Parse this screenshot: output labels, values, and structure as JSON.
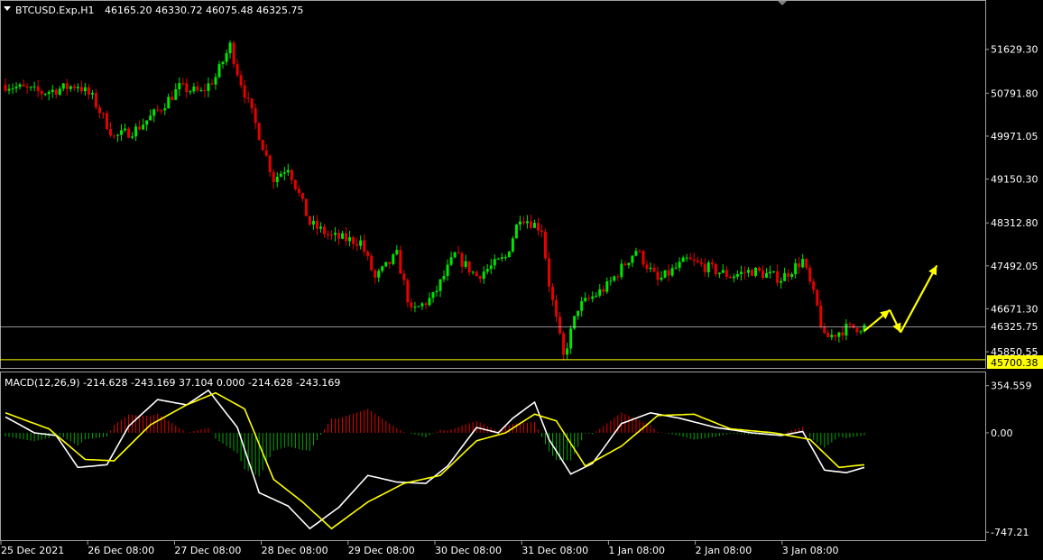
{
  "header": {
    "symbol": "BTCUSD.Exp,H1",
    "ohlc": "46165.20 46330.72 46075.48 46325.75"
  },
  "macd_header": "MACD(12,26,9) -214.628 -243.169 37.104 0.000 -214.628 -243.169",
  "colors": {
    "background": "#000000",
    "bull": "#00e600",
    "bear": "#e60000",
    "macd_line": "#ffffff",
    "signal_line": "#ffff00",
    "hist_pos": "#e60000",
    "hist_neg": "#00aa00",
    "price_line": "#c0c0c0",
    "support_line": "#ffff00",
    "support_label_bg": "#ffff00",
    "arrows": "#ffff00"
  },
  "chart_data": [
    {
      "type": "candlestick",
      "y_ticks": [
        51629.3,
        50791.8,
        49971.05,
        49150.3,
        48312.8,
        47492.05,
        46671.3,
        45850.55
      ],
      "ylim": [
        45680,
        52400
      ],
      "current_price": "46325.75",
      "support_level": "45700.38",
      "x_tick_labels": [
        "25 Dec 2021",
        "26 Dec 08:00",
        "27 Dec 08:00",
        "28 Dec 08:00",
        "29 Dec 08:00",
        "30 Dec 08:00",
        "31 Dec 08:00",
        "1 Jan 08:00",
        "2 Jan 08:00",
        "3 Jan 08:00"
      ],
      "close_path_anchors": [
        [
          0,
          50950
        ],
        [
          10,
          50800
        ],
        [
          20,
          50950
        ],
        [
          24,
          50700
        ],
        [
          30,
          49950
        ],
        [
          36,
          50100
        ],
        [
          42,
          50450
        ],
        [
          48,
          50900
        ],
        [
          54,
          50800
        ],
        [
          58,
          51100
        ],
        [
          62,
          51700
        ],
        [
          64,
          51200
        ],
        [
          70,
          50000
        ],
        [
          74,
          49150
        ],
        [
          78,
          49400
        ],
        [
          84,
          48300
        ],
        [
          90,
          48050
        ],
        [
          98,
          47950
        ],
        [
          102,
          47250
        ],
        [
          108,
          47700
        ],
        [
          112,
          46600
        ],
        [
          118,
          46900
        ],
        [
          124,
          47700
        ],
        [
          130,
          47300
        ],
        [
          138,
          47650
        ],
        [
          142,
          48450
        ],
        [
          148,
          48200
        ],
        [
          150,
          47150
        ],
        [
          154,
          45750
        ],
        [
          158,
          46700
        ],
        [
          166,
          47100
        ],
        [
          174,
          47800
        ],
        [
          180,
          47200
        ],
        [
          188,
          47600
        ],
        [
          200,
          47300
        ],
        [
          206,
          47400
        ],
        [
          214,
          47250
        ],
        [
          220,
          47600
        ],
        [
          224,
          46700
        ],
        [
          226,
          46100
        ],
        [
          232,
          46300
        ],
        [
          237,
          46330
        ]
      ],
      "macd_ticks": [
        354.559,
        0.0,
        -747.21
      ],
      "macd_ylim": [
        -800,
        420
      ],
      "macd_anchors": [
        [
          0,
          120
        ],
        [
          8,
          0
        ],
        [
          14,
          -20
        ],
        [
          20,
          -260
        ],
        [
          28,
          -240
        ],
        [
          34,
          50
        ],
        [
          42,
          250
        ],
        [
          50,
          210
        ],
        [
          56,
          320
        ],
        [
          64,
          40
        ],
        [
          70,
          -450
        ],
        [
          78,
          -550
        ],
        [
          84,
          -720
        ],
        [
          92,
          -560
        ],
        [
          100,
          -320
        ],
        [
          108,
          -370
        ],
        [
          116,
          -380
        ],
        [
          122,
          -250
        ],
        [
          130,
          40
        ],
        [
          136,
          0
        ],
        [
          140,
          110
        ],
        [
          146,
          230
        ],
        [
          150,
          -50
        ],
        [
          156,
          -310
        ],
        [
          162,
          -230
        ],
        [
          170,
          70
        ],
        [
          178,
          150
        ],
        [
          186,
          110
        ],
        [
          196,
          40
        ],
        [
          206,
          0
        ],
        [
          214,
          -20
        ],
        [
          220,
          10
        ],
        [
          226,
          -280
        ],
        [
          232,
          -300
        ],
        [
          237,
          -260
        ]
      ],
      "signal_anchors": [
        [
          0,
          150
        ],
        [
          12,
          30
        ],
        [
          22,
          -200
        ],
        [
          30,
          -210
        ],
        [
          40,
          60
        ],
        [
          50,
          210
        ],
        [
          58,
          300
        ],
        [
          66,
          180
        ],
        [
          74,
          -350
        ],
        [
          82,
          -520
        ],
        [
          90,
          -720
        ],
        [
          100,
          -520
        ],
        [
          110,
          -380
        ],
        [
          120,
          -320
        ],
        [
          130,
          -60
        ],
        [
          138,
          0
        ],
        [
          146,
          140
        ],
        [
          152,
          90
        ],
        [
          160,
          -250
        ],
        [
          170,
          -100
        ],
        [
          180,
          130
        ],
        [
          190,
          140
        ],
        [
          200,
          30
        ],
        [
          212,
          0
        ],
        [
          222,
          -50
        ],
        [
          230,
          -260
        ],
        [
          237,
          -240
        ]
      ],
      "forecast_arrow": [
        [
          237,
          46250
        ],
        [
          244,
          46650
        ],
        [
          247,
          46220
        ],
        [
          257,
          47500
        ]
      ],
      "candle_count": 238
    }
  ]
}
